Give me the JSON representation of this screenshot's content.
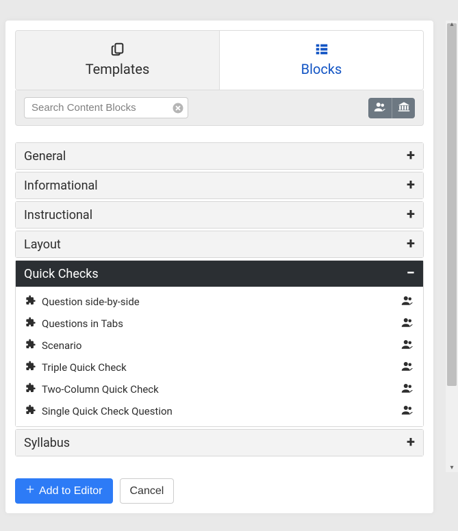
{
  "tabs": {
    "templates_label": "Templates",
    "blocks_label": "Blocks"
  },
  "search": {
    "placeholder": "Search Content Blocks",
    "value": ""
  },
  "categories": [
    {
      "label": "General",
      "expanded": false
    },
    {
      "label": "Informational",
      "expanded": false
    },
    {
      "label": "Instructional",
      "expanded": false
    },
    {
      "label": "Layout",
      "expanded": false
    },
    {
      "label": "Quick Checks",
      "expanded": true,
      "items": [
        {
          "label": "Question side-by-side"
        },
        {
          "label": "Questions in Tabs"
        },
        {
          "label": "Scenario"
        },
        {
          "label": "Triple Quick Check"
        },
        {
          "label": "Two-Column Quick Check"
        },
        {
          "label": "Single Quick Check Question"
        }
      ]
    },
    {
      "label": "Syllabus",
      "expanded": false
    }
  ],
  "footer": {
    "add_label": "Add to Editor",
    "cancel_label": "Cancel"
  }
}
